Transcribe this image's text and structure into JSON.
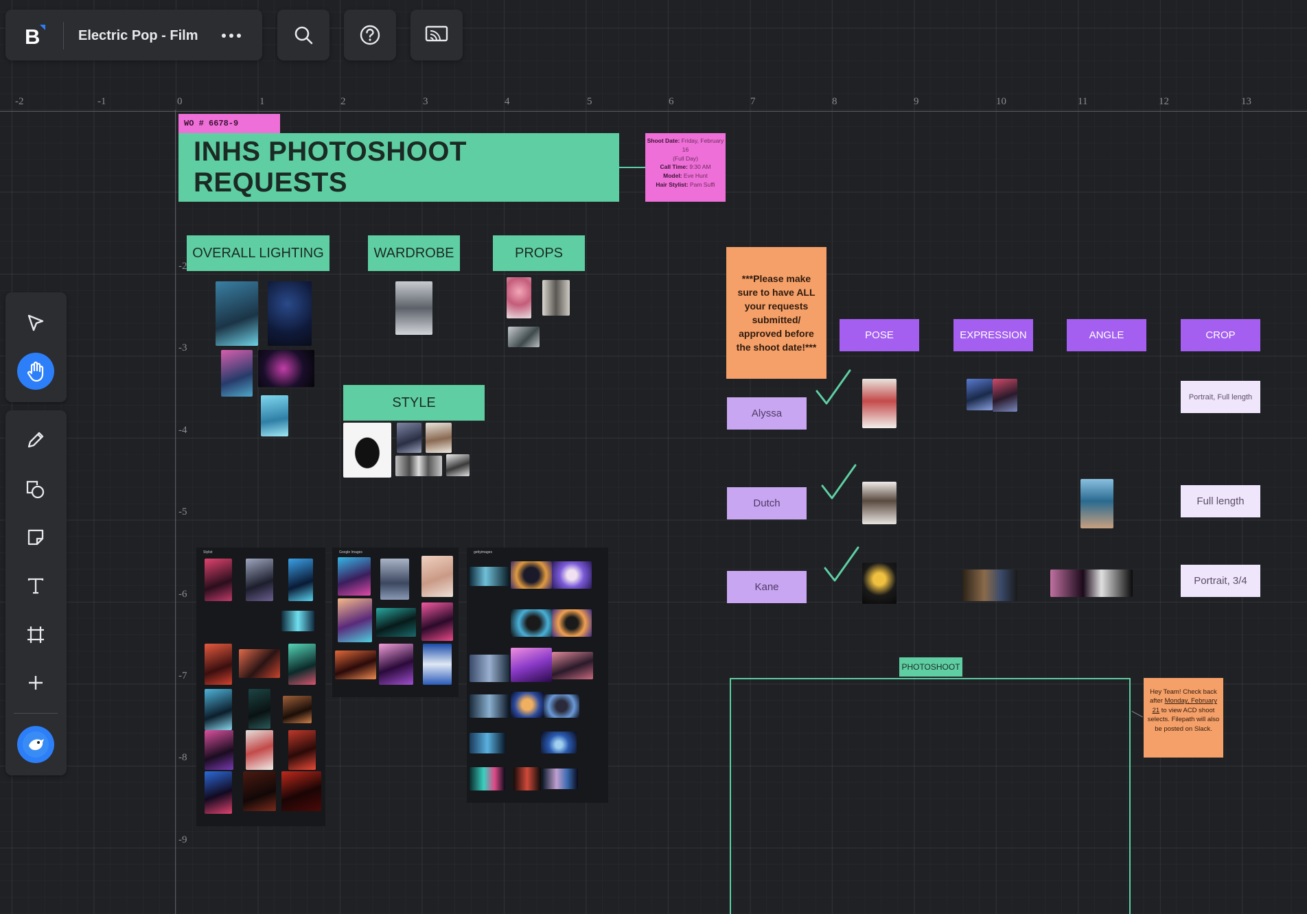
{
  "app": {
    "logo": "B",
    "board_title": "Electric Pop - Film",
    "menu_icon": "more-horizontal-icon",
    "search_icon": "search-icon",
    "help_icon": "help-circle-icon",
    "present_icon": "cast-icon"
  },
  "ruler": {
    "x_ticks": [
      "-2",
      "-1",
      "0",
      "1",
      "2",
      "3",
      "4",
      "5",
      "6",
      "7",
      "8",
      "9",
      "10",
      "11",
      "12",
      "13"
    ],
    "y_ticks": [
      "-2",
      "-3",
      "-4",
      "-5",
      "-6",
      "-7",
      "-8",
      "-9"
    ]
  },
  "toolbar": {
    "tools": [
      "select-pointer-icon",
      "hand-pan-icon",
      "pen-icon",
      "shapes-icon",
      "sticky-note-icon",
      "text-icon",
      "frame-icon",
      "add-icon",
      "avatar-icon"
    ],
    "active": "hand-pan-icon"
  },
  "board": {
    "wo_tag": "WO # 6678-9",
    "title": "INHS PHOTOSHOOT REQUESTS",
    "shoot_info": {
      "shoot_date_label": "Shoot Date:",
      "shoot_date": "Friday, February 16",
      "duration": "(Full Day)",
      "call_time_label": "Call Time:",
      "call_time": "9:30 AM",
      "model_label": "Model:",
      "model": "Eve Hunt",
      "hair_label": "Hair Stylist:",
      "hair": "Pam Suffi"
    },
    "sections": {
      "lighting": "OVERALL LIGHTING",
      "wardrobe": "WARDROBE",
      "props": "PROPS",
      "style": "STYLE"
    },
    "reminder": "***Please make sure to have ALL your requests submitted/ approved before the shoot date!***",
    "columns": [
      "POSE",
      "EXPRESSION",
      "ANGLE",
      "CROP"
    ],
    "rows": [
      {
        "name": "Alyssa",
        "crop": "Portrait, Full length"
      },
      {
        "name": "Dutch",
        "crop": "Full length"
      },
      {
        "name": "Kane",
        "crop": "Portrait, 3/4"
      }
    ],
    "frame_label": "PHOTOSHOOT",
    "team_note": {
      "pre": "Hey Team! Check back after ",
      "date": "Monday, February 21",
      "post": " to view ACD shoot selects. Filepath will also be posted on Slack."
    },
    "boards": {
      "b1": "Stylist",
      "b2": "Google Images",
      "b3": "gettyimages"
    }
  },
  "colors": {
    "canvas": "#1f2125",
    "teal": "#5fcfa3",
    "pink": "#ee6fd8",
    "purple": "#a45ef0",
    "orange": "#f5a068",
    "accent_blue": "#2d7ff9"
  }
}
